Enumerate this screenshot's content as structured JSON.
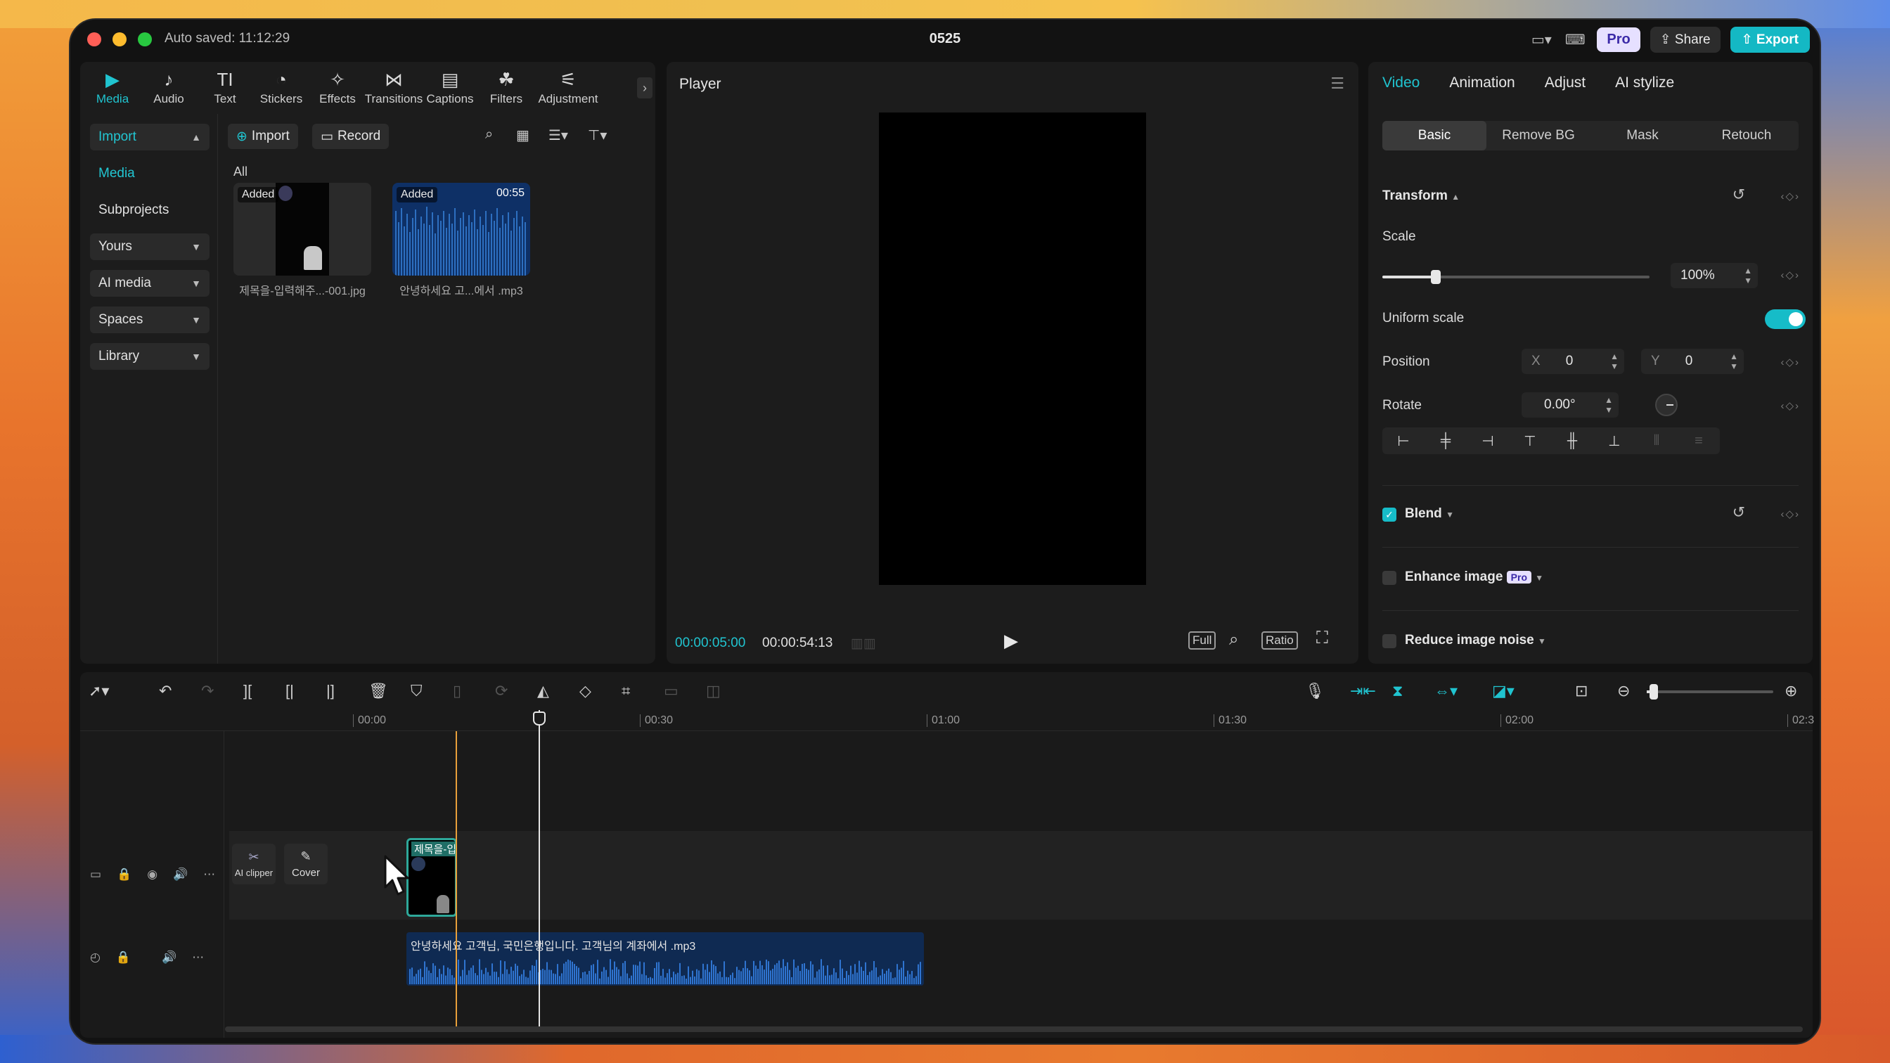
{
  "window": {
    "autosaved": "Auto saved: 11:12:29",
    "title": "0525",
    "pro_label": "Pro",
    "share_label": "Share",
    "export_label": "Export"
  },
  "toolbar": [
    {
      "label": "Media",
      "icon": "media-icon"
    },
    {
      "label": "Audio",
      "icon": "audio-icon"
    },
    {
      "label": "Text",
      "icon": "text-icon"
    },
    {
      "label": "Stickers",
      "icon": "stickers-icon"
    },
    {
      "label": "Effects",
      "icon": "effects-icon"
    },
    {
      "label": "Transitions",
      "icon": "transitions-icon"
    },
    {
      "label": "Captions",
      "icon": "captions-icon"
    },
    {
      "label": "Filters",
      "icon": "filters-icon"
    },
    {
      "label": "Adjustment",
      "icon": "adjustment-icon"
    }
  ],
  "sidenav": {
    "import": "Import",
    "media": "Media",
    "subprojects": "Subprojects",
    "yours": "Yours",
    "ai_media": "AI media",
    "spaces": "Spaces",
    "library": "Library"
  },
  "media": {
    "import_btn": "Import",
    "record_btn": "Record",
    "filter_all": "All",
    "items": [
      {
        "badge": "Added",
        "name": "제목을-입력해주...-001.jpg",
        "duration": ""
      },
      {
        "badge": "Added",
        "name": "안녕하세요 고...에서 .mp3",
        "duration": "00:55"
      }
    ]
  },
  "player": {
    "title": "Player",
    "current_time": "00:00:05:00",
    "total_time": "00:00:54:13",
    "full_label": "Full",
    "ratio_label": "Ratio"
  },
  "props": {
    "tabs": [
      "Video",
      "Animation",
      "Adjust",
      "AI stylize"
    ],
    "subtabs": [
      "Basic",
      "Remove BG",
      "Mask",
      "Retouch"
    ],
    "transform": "Transform",
    "scale_label": "Scale",
    "scale_value": "100%",
    "scale_level": 0.2,
    "uniform_scale": "Uniform scale",
    "position_label": "Position",
    "pos_x_label": "X",
    "pos_x": "0",
    "pos_y_label": "Y",
    "pos_y": "0",
    "rotate_label": "Rotate",
    "rotate_value": "0.00°",
    "blend": "Blend",
    "enhance": "Enhance image",
    "enhance_badge": "Pro",
    "reduce_noise": "Reduce image noise"
  },
  "timeline": {
    "ticks": [
      "00:00",
      "00:30",
      "01:00",
      "01:30",
      "02:00",
      "02:3"
    ],
    "ai_clipper": "AI clipper",
    "cover": "Cover",
    "video_clip_name": "제목을-입",
    "audio_clip_name": "안녕하세요 고객님, 국민은행입니다. 고객님의 계좌에서 .mp3"
  },
  "colors": {
    "accent": "#20c4d0",
    "audio_clip": "#0f2a52",
    "video_clip_border": "#2ea89a"
  }
}
